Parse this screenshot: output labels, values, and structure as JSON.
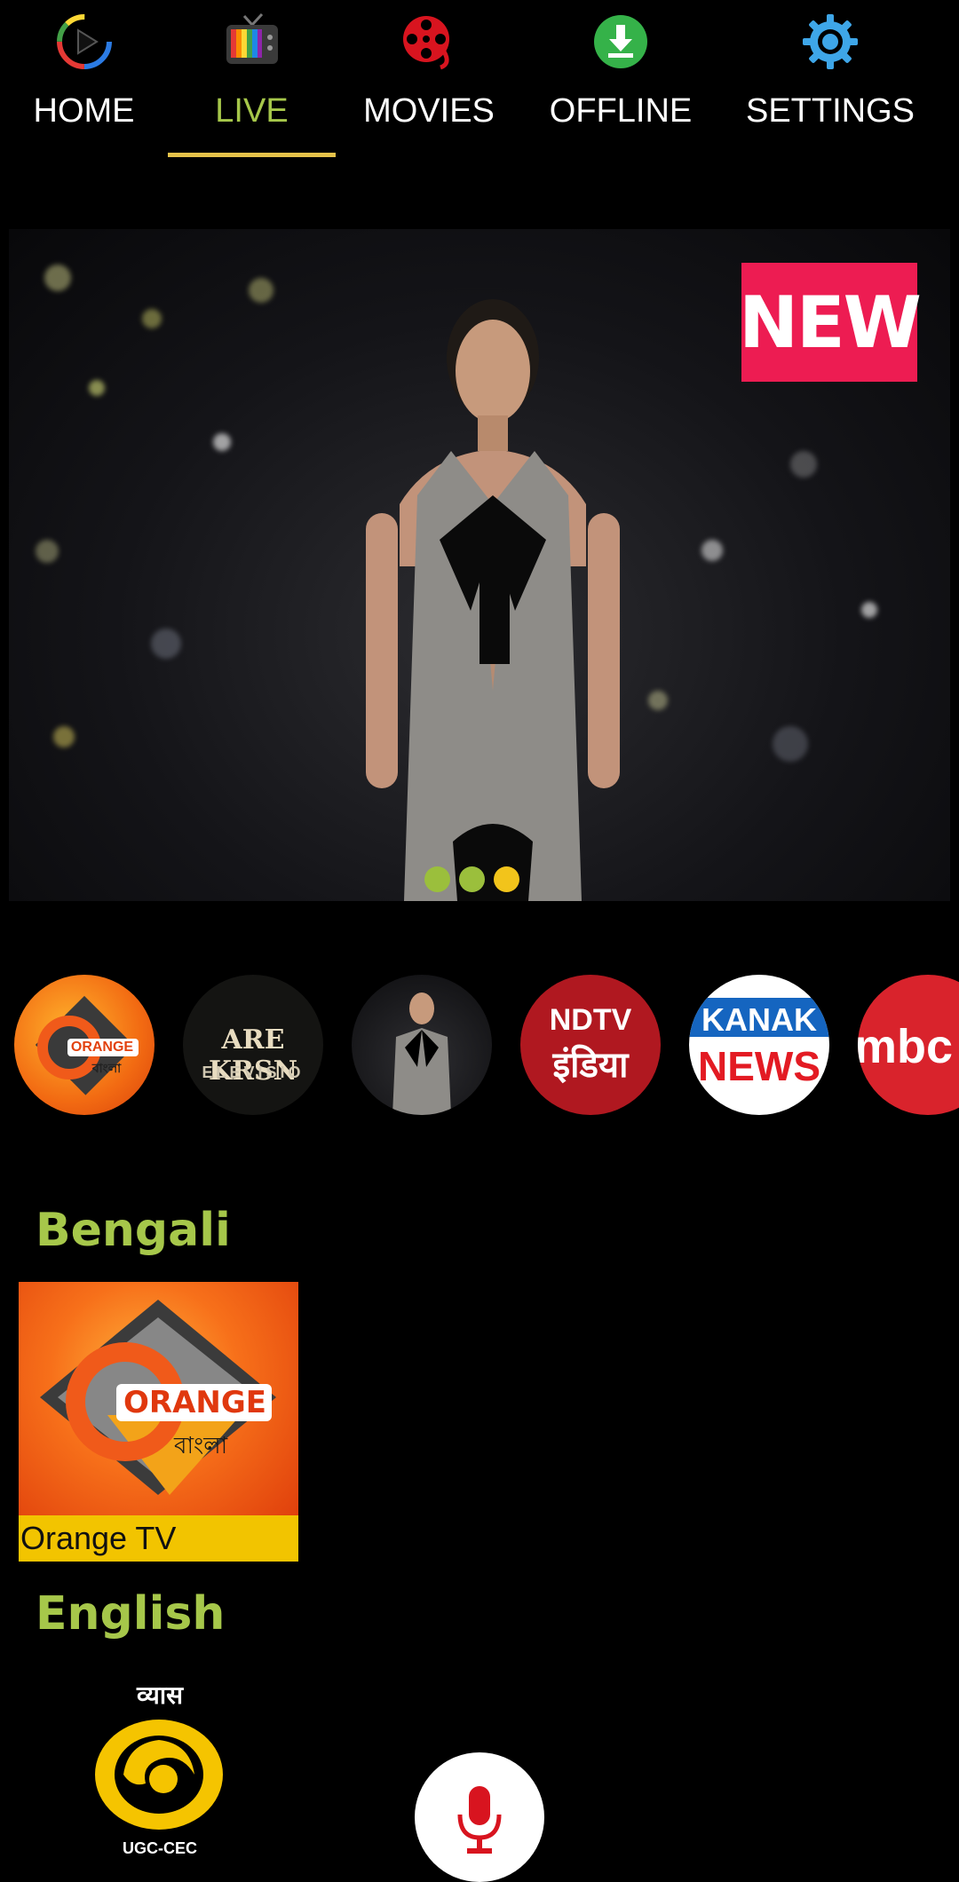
{
  "nav": {
    "items": [
      {
        "label": "HOME",
        "icon": "play-circle-icon"
      },
      {
        "label": "LIVE",
        "icon": "tv-icon",
        "active": true
      },
      {
        "label": "MOVIES",
        "icon": "film-reel-icon"
      },
      {
        "label": "OFFLINE",
        "icon": "download-icon"
      },
      {
        "label": "SETTINGS",
        "icon": "gear-icon"
      }
    ],
    "active_color": "#a6c74a",
    "underline_color": "#e6c34a"
  },
  "banner": {
    "badge": "NEW",
    "badge_color": "#ed1c52",
    "pager": {
      "count": 3,
      "active_index": 2,
      "dot_color": "#9bbf3c",
      "active_dot_color": "#f2c41b"
    }
  },
  "channels": [
    {
      "name": "orange-bangla",
      "logo_text": "ORANGE",
      "logo_subtext": "বাংলা"
    },
    {
      "name": "hare-krsna",
      "logo_text": "ARE KRSN",
      "logo_subtext": "ELEVISIO"
    },
    {
      "name": "fashion",
      "logo_text": ""
    },
    {
      "name": "ndtv-india",
      "logo_text": "NDTV",
      "logo_subtext": "इंडिया"
    },
    {
      "name": "kanak-news",
      "logo_text": "KANAK",
      "logo_subtext": "NEWS"
    },
    {
      "name": "mbc",
      "logo_text": "mbc"
    }
  ],
  "sections": [
    {
      "title": "Bengali",
      "items": [
        {
          "caption": "Orange TV",
          "logo_text": "ORANGE",
          "logo_subtext": "বাংলা"
        }
      ]
    },
    {
      "title": "English",
      "items": [
        {
          "logo_text": "व्यास",
          "logo_subtext": "UGC-CEC"
        }
      ]
    }
  ],
  "accent": "#a6c74a"
}
